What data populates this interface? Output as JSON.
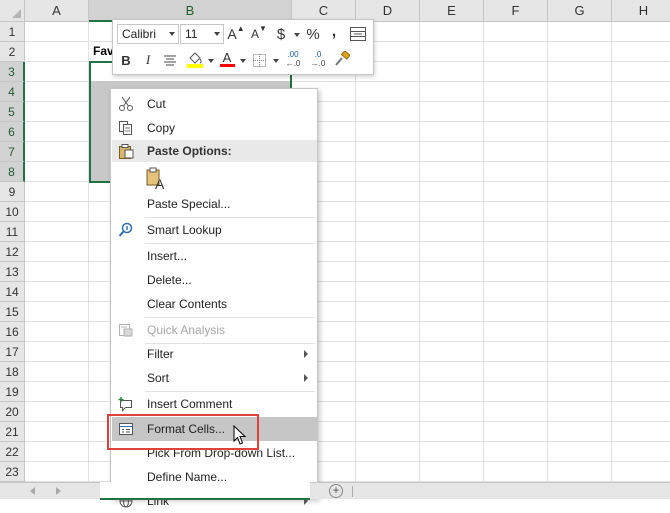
{
  "columns": [
    "A",
    "B",
    "C",
    "D",
    "E",
    "F",
    "G",
    "H"
  ],
  "rows": [
    "1",
    "2",
    "3",
    "4",
    "5",
    "6",
    "7",
    "8",
    "9",
    "10",
    "11",
    "12",
    "13",
    "14",
    "15",
    "16",
    "17",
    "18",
    "19",
    "20",
    "21",
    "22",
    "23"
  ],
  "selected_column": "B",
  "selected_rows": [
    "3",
    "4",
    "5",
    "6",
    "7",
    "8"
  ],
  "cell_b2_text": "Fav",
  "accent_color": "#217346",
  "highlight_box_color": "#e0423a",
  "mini_toolbar": {
    "font_name": "Calibri",
    "font_size": "11",
    "increase_font": "A",
    "decrease_font": "A",
    "currency": "$",
    "percent": "%",
    "comma": ",",
    "bold": "B",
    "italic": "I",
    "font_color_letter": "A",
    "inc_decimal": ".00",
    "dec_decimal": ".0",
    "fill_color": "#ffff00",
    "font_color": "#ff0000"
  },
  "context_menu": {
    "cut": "Cut",
    "copy": "Copy",
    "paste_options": "Paste Options:",
    "paste_special": "Paste Special...",
    "smart_lookup": "Smart Lookup",
    "insert": "Insert...",
    "delete": "Delete...",
    "clear_contents": "Clear Contents",
    "quick_analysis": "Quick Analysis",
    "filter": "Filter",
    "sort": "Sort",
    "insert_comment": "Insert Comment",
    "format_cells": "Format Cells...",
    "pick_from_list": "Pick From Drop-down List...",
    "define_name": "Define Name...",
    "link": "Link"
  }
}
